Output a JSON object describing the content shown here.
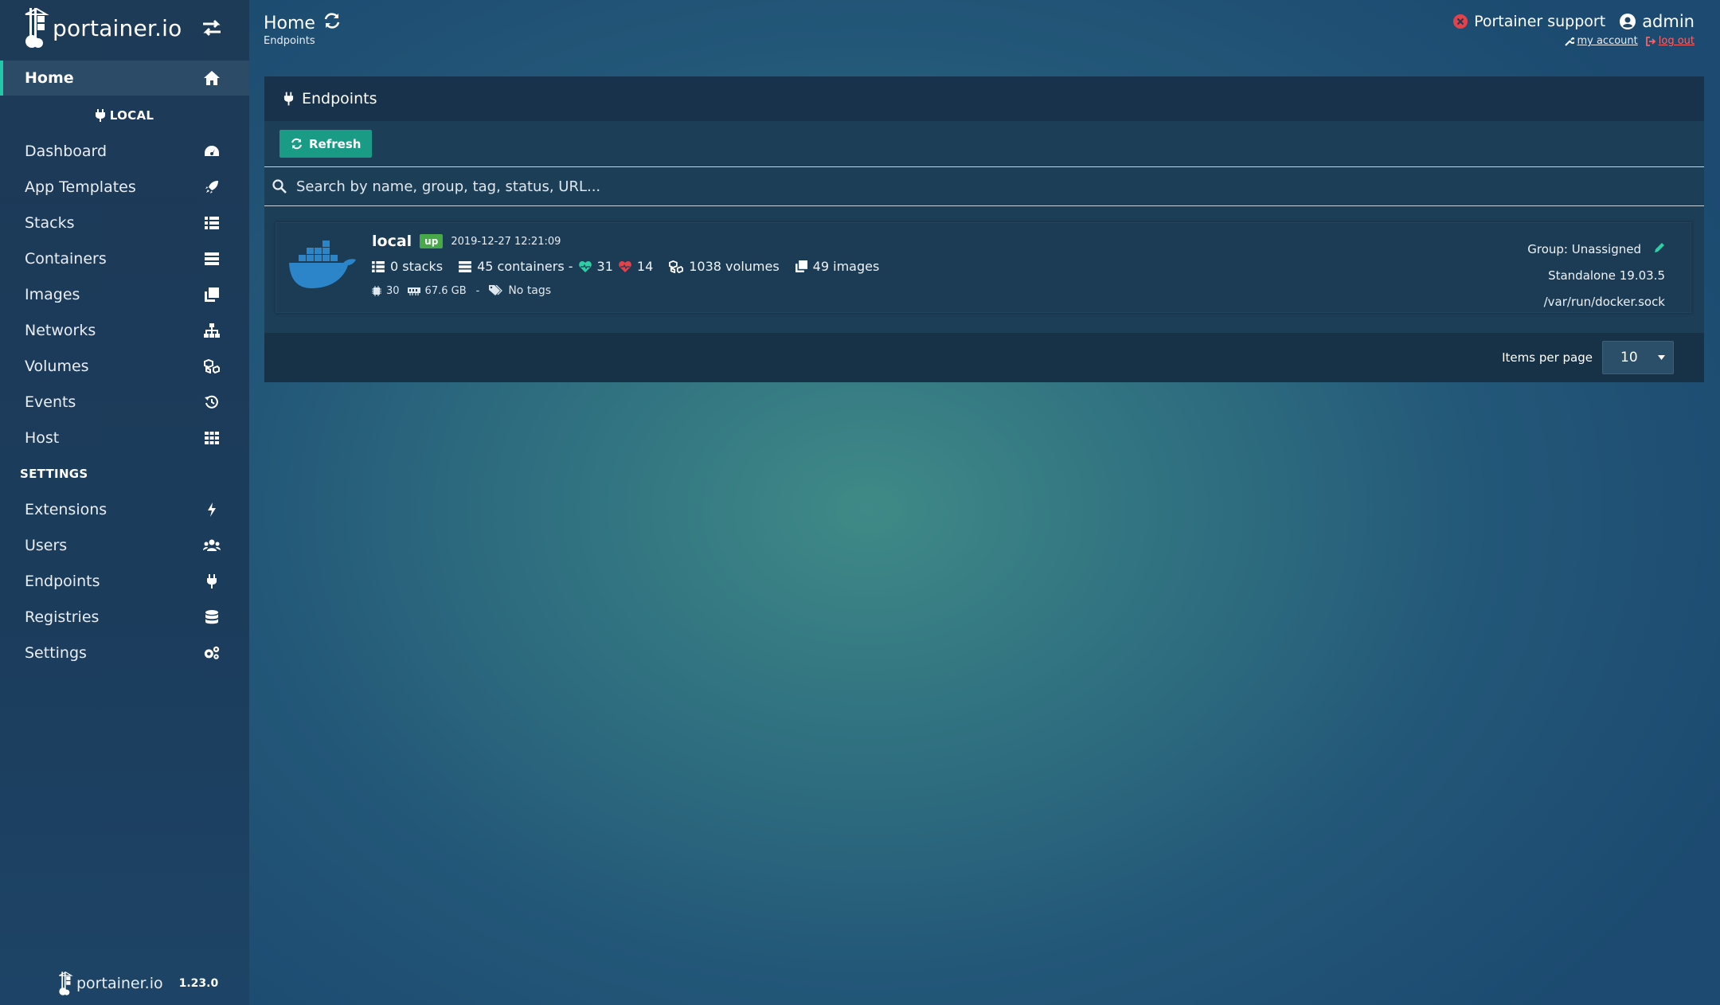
{
  "brand": {
    "name": "portainer.io"
  },
  "sidebar": {
    "home_label": "Home",
    "endpoint_section": "LOCAL",
    "items": [
      {
        "label": "Dashboard",
        "icon": "tachometer-icon"
      },
      {
        "label": "App Templates",
        "icon": "rocket-icon"
      },
      {
        "label": "Stacks",
        "icon": "th-list-icon"
      },
      {
        "label": "Containers",
        "icon": "server-icon"
      },
      {
        "label": "Images",
        "icon": "clone-icon"
      },
      {
        "label": "Networks",
        "icon": "sitemap-icon"
      },
      {
        "label": "Volumes",
        "icon": "cubes-icon"
      },
      {
        "label": "Events",
        "icon": "history-icon"
      },
      {
        "label": "Host",
        "icon": "th-icon"
      }
    ],
    "settings_section": "SETTINGS",
    "settings_items": [
      {
        "label": "Extensions",
        "icon": "bolt-icon"
      },
      {
        "label": "Users",
        "icon": "users-icon"
      },
      {
        "label": "Endpoints",
        "icon": "plug-icon"
      },
      {
        "label": "Registries",
        "icon": "database-icon"
      },
      {
        "label": "Settings",
        "icon": "cogs-icon"
      }
    ],
    "footer_brand": "portainer.io",
    "version": "1.23.0"
  },
  "header": {
    "title": "Home",
    "breadcrumb": "Endpoints",
    "support_label": "Portainer support",
    "user": "admin",
    "my_account": "my account",
    "log_out": "log out"
  },
  "widget": {
    "title": "Endpoints",
    "refresh_label": "Refresh",
    "search_placeholder": "Search by name, group, tag, status, URL...",
    "items_per_page_label": "Items per page",
    "items_per_page_value": "10"
  },
  "endpoint": {
    "name": "local",
    "status": "up",
    "timestamp": "2019-12-27 12:21:09",
    "stacks": "0 stacks",
    "containers": "45 containers -",
    "healthy": "31",
    "unhealthy": "14",
    "volumes": "1038 volumes",
    "images": "49 images",
    "cpu": "30",
    "memory": "67.6 GB",
    "separator": "-",
    "tags": "No tags",
    "group": "Group: Unassigned",
    "engine": "Standalone 19.03.5",
    "url": "/var/run/docker.sock"
  },
  "colors": {
    "accent": "#23c6a7",
    "refresh_button": "#1a9b86",
    "status_up": "#47a947",
    "healthy": "#2fcfa6",
    "unhealthy": "#e2424a",
    "logout": "#ff6161"
  }
}
